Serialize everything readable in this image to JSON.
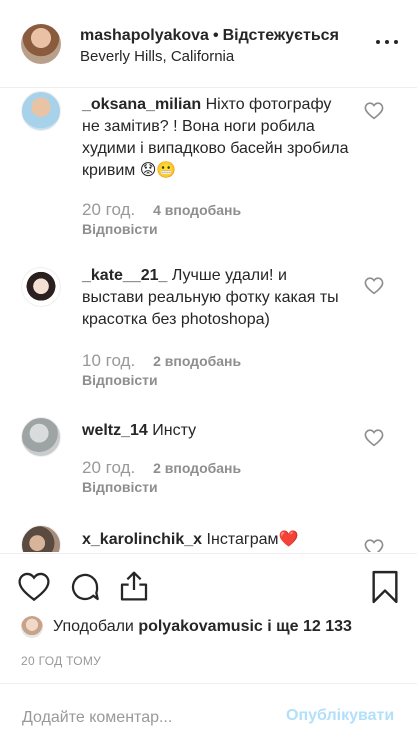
{
  "header": {
    "username": "mashapolyakova",
    "separator": "•",
    "follow_status": "Відстежується",
    "location": "Beverly Hills, California",
    "more_icon": "more-horizontal-icon"
  },
  "comments": [
    {
      "username": "_oksana_milian",
      "text": "Ніхто фотографу не замітив? ! Вона ноги робила худими і випадково басейн зробила кривим 😟😬",
      "time": "20 год.",
      "likes": "4 вподобань",
      "reply": "Відповісти"
    },
    {
      "username": "_kate__21_",
      "text": "Лучше удали! и выстави реальную фотку какая ты красотка без photoshopa)",
      "time": "10 год.",
      "likes": "2 вподобань",
      "reply": "Відповісти"
    },
    {
      "username": "weltz_14",
      "text": "Инсту",
      "time": "20 год.",
      "likes": "2 вподобань",
      "reply": "Відповісти"
    },
    {
      "username": "x_karolinchik_x",
      "text": "Інстаграм❤️",
      "time": "",
      "likes": "",
      "reply": ""
    }
  ],
  "likes_line": {
    "prefix": "Уподобали",
    "user": "polyakovamusic",
    "suffix": "і ще 12 133"
  },
  "posted_ago": "20 ГОД ТОМУ",
  "add_comment": {
    "placeholder": "Додайте коментар...",
    "post_label": "Опублікувати"
  },
  "icons": [
    "heart-icon",
    "comment-icon",
    "share-icon",
    "bookmark-icon"
  ],
  "colors": {
    "post_button_disabled": "#b2dffc",
    "meta_gray": "#8e8e8e"
  }
}
